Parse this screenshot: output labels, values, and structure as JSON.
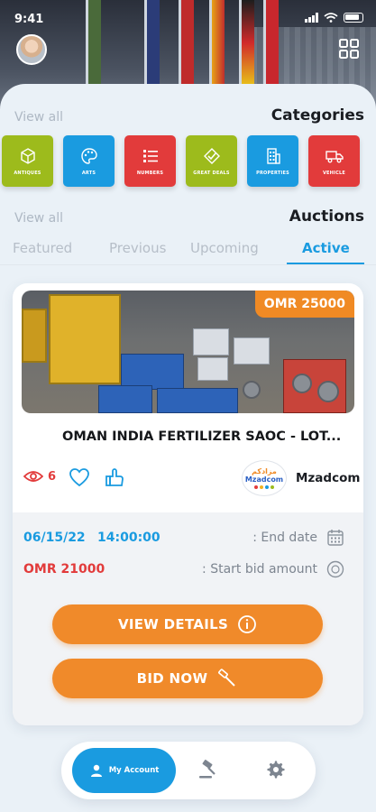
{
  "status_bar": {
    "time": "9:41"
  },
  "header": {
    "avatar_icon": "user-avatar",
    "grid_icon": "grid-icon"
  },
  "categories_section": {
    "view_all": "View all",
    "title": "Categories",
    "items": [
      {
        "label": "Antiques",
        "icon": "cube-icon",
        "color": "#9dbb1c"
      },
      {
        "label": "Arts",
        "icon": "palette-icon",
        "color": "#1a9be0"
      },
      {
        "label": "Numbers",
        "icon": "list-icon",
        "color": "#e23b3b"
      },
      {
        "label": "Great Deals",
        "icon": "tag-icon",
        "color": "#9dbb1c"
      },
      {
        "label": "Properties",
        "icon": "building-icon",
        "color": "#1a9be0"
      },
      {
        "label": "Vehicle",
        "icon": "truck-icon",
        "color": "#e23b3b"
      }
    ]
  },
  "auctions_section": {
    "view_all": "View all",
    "title": "Auctions",
    "tabs": [
      "Featured",
      "Previous",
      "Upcoming",
      "Active"
    ],
    "active_tab": "Active"
  },
  "auction_card": {
    "price_tag": "OMR 25000",
    "title": "OMAN INDIA FERTILIZER SAOC - LOT...",
    "views": "6",
    "seller": {
      "logo_arabic": "مزادكم",
      "logo_text": "Mzadcom",
      "name": "Mzadcom"
    },
    "end_date": "06/15/22",
    "end_time": "14:00:00",
    "end_label": ": End date",
    "start_bid_amount": "OMR 21000",
    "start_label": ": Start bid amount",
    "view_details_label": "VIEW DETAILS",
    "bid_now_label": "BID NOW"
  },
  "bottom_nav": {
    "account_label": "My Account"
  },
  "colors": {
    "accent_blue": "#1a9be0",
    "accent_orange": "#f08a2a",
    "accent_red": "#e23b3b",
    "accent_green": "#9dbb1c"
  }
}
